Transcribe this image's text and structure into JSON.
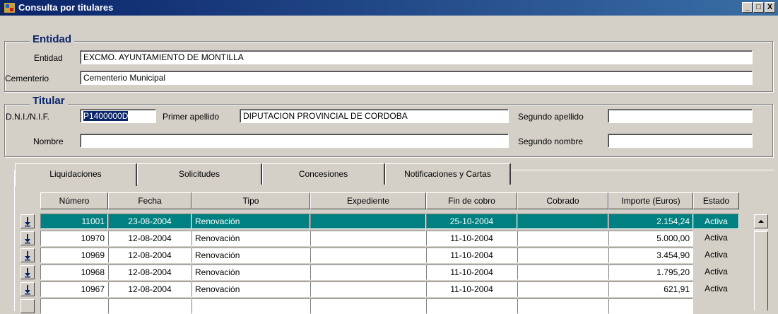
{
  "window": {
    "title": "Consulta por titulares",
    "icon": "app-icon",
    "buttons": [
      "_",
      "□",
      "X"
    ]
  },
  "entidad_group": {
    "legend": "Entidad",
    "entidad_label": "Entidad",
    "entidad_value": "EXCMO. AYUNTAMIENTO DE MONTILLA",
    "cementerio_label": "Cementerio",
    "cementerio_value": "Cementerio Municipal"
  },
  "titular_group": {
    "legend": "Titular",
    "dni_label": "D.N.I./N.I.F.",
    "dni_value": "P1400000D",
    "primer_apellido_label": "Primer apellido",
    "primer_apellido_value": "DIPUTACION PROVINCIAL DE CORDOBA",
    "segundo_apellido_label": "Segundo apellido",
    "segundo_apellido_value": "",
    "nombre_label": "Nombre",
    "nombre_value": "",
    "segundo_nombre_label": "Segundo nombre",
    "segundo_nombre_value": ""
  },
  "tabs": [
    "Liquidaciones",
    "Solicitudes",
    "Concesiones",
    "Notificaciones y Cartas"
  ],
  "active_tab": "Liquidaciones",
  "table": {
    "columns": [
      "Número",
      "Fecha",
      "Tipo",
      "Expediente",
      "Fin de cobro",
      "Cobrado",
      "Importe (Euros)",
      "Estado"
    ],
    "rows": [
      [
        "11001",
        "23-08-2004",
        "Renovación",
        "",
        "25-10-2004",
        "",
        "2.154,24",
        "Activa"
      ],
      [
        "10970",
        "12-08-2004",
        "Renovación",
        "",
        "11-10-2004",
        "",
        "5.000,00",
        "Activa"
      ],
      [
        "10969",
        "12-08-2004",
        "Renovación",
        "",
        "11-10-2004",
        "",
        "3.454,90",
        "Activa"
      ],
      [
        "10968",
        "12-08-2004",
        "Renovación",
        "",
        "11-10-2004",
        "",
        "1.795,20",
        "Activa"
      ],
      [
        "10967",
        "12-08-2004",
        "Renovación",
        "",
        "11-10-2004",
        "",
        "621,91",
        "Activa"
      ],
      [
        "",
        "",
        "",
        "",
        "",
        "",
        "",
        ""
      ]
    ],
    "selected_row": 0,
    "row_button_icon": "arrow-down-icon"
  },
  "colors": {
    "title_bar": "#0a246a",
    "selection": "#008080",
    "legend": "#0a246a",
    "face": "#d4d0c8"
  }
}
